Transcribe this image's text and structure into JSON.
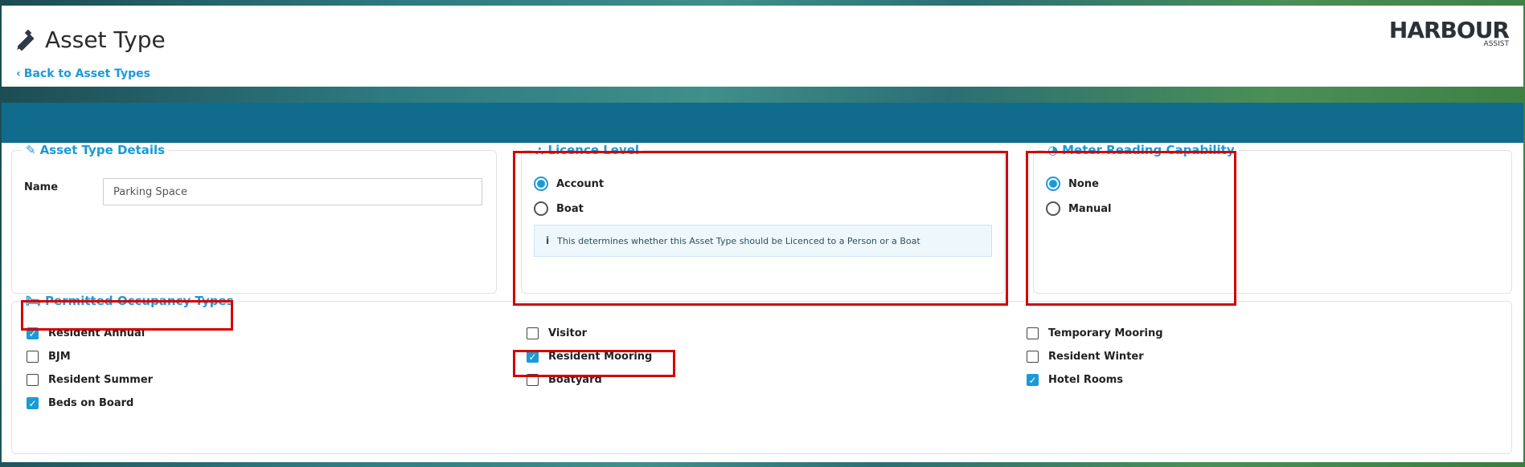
{
  "header": {
    "title": "Asset Type",
    "back_link": "Back to Asset Types",
    "logo_main": "HARBOUR",
    "logo_sub": "ASSIST"
  },
  "asset_details": {
    "legend": "Asset Type Details",
    "name_label": "Name",
    "name_value": "Parking Space"
  },
  "licence": {
    "legend": "Licence Level",
    "options": [
      {
        "label": "Account",
        "selected": true
      },
      {
        "label": "Boat",
        "selected": false
      }
    ],
    "info": "This determines whether this Asset Type should be Licenced to a Person or a Boat"
  },
  "meter": {
    "legend": "Meter Reading Capability",
    "options": [
      {
        "label": "None",
        "selected": true
      },
      {
        "label": "Manual",
        "selected": false
      }
    ]
  },
  "occupancy": {
    "legend": "Permitted Occupancy Types",
    "col1": [
      {
        "label": "Resident Annual",
        "checked": true
      },
      {
        "label": "BJM",
        "checked": false
      },
      {
        "label": "Resident Summer",
        "checked": false
      },
      {
        "label": "Beds on Board",
        "checked": true
      }
    ],
    "col2": [
      {
        "label": "Visitor",
        "checked": false
      },
      {
        "label": "Resident Mooring",
        "checked": true
      },
      {
        "label": "Boatyard",
        "checked": false
      }
    ],
    "col3": [
      {
        "label": "Temporary Mooring",
        "checked": false
      },
      {
        "label": "Resident Winter",
        "checked": false
      },
      {
        "label": "Hotel Rooms",
        "checked": true
      }
    ]
  },
  "colors": {
    "accent": "#1a9ad7",
    "bar": "#116b8d",
    "highlight": "#d40000"
  }
}
